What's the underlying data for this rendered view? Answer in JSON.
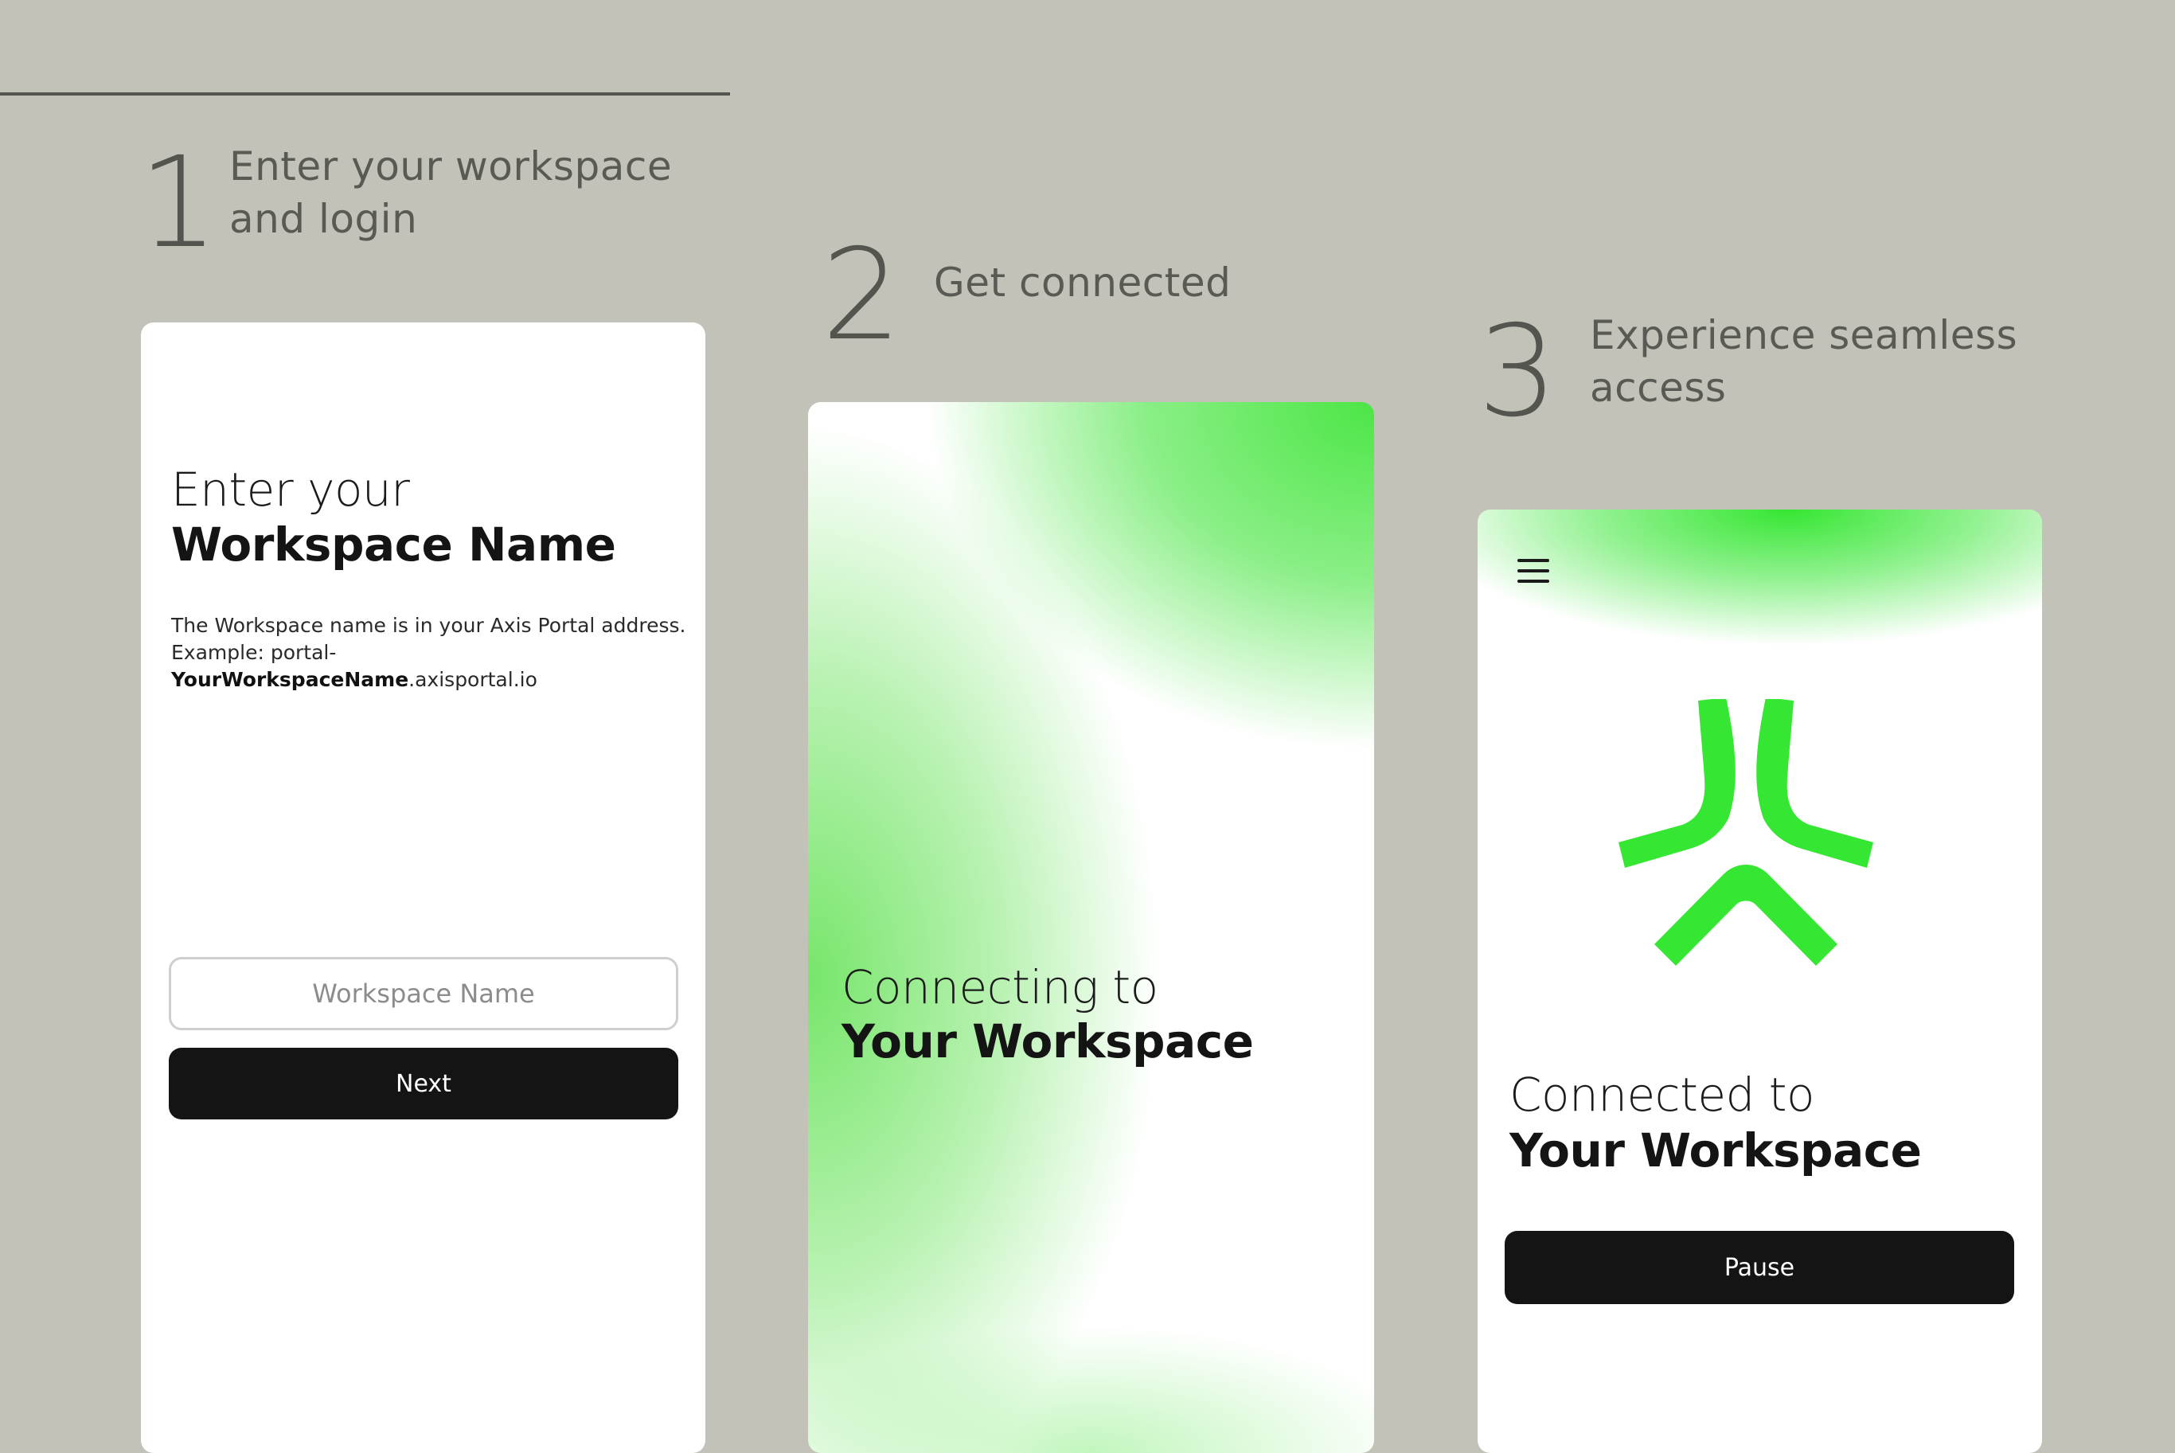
{
  "steps": [
    {
      "number": "1",
      "line1": "Enter your workspace",
      "line2": "and login"
    },
    {
      "number": "2",
      "line1": "Get connected"
    },
    {
      "number": "3",
      "line1": "Experience seamless",
      "line2": "access"
    }
  ],
  "screen1": {
    "heading_light": "Enter your",
    "heading_bold": "Workspace Name",
    "hint_line1": "The Workspace name is in your Axis Portal address.",
    "hint_prefix": "Example: portal-",
    "hint_bold": "YourWorkspaceName",
    "hint_suffix": ".axisportal.io",
    "input_placeholder": "Workspace Name",
    "button_label": "Next"
  },
  "screen2": {
    "heading_light": "Connecting to",
    "heading_bold": "Your Workspace"
  },
  "screen3": {
    "menu_icon": "hamburger-menu-icon",
    "logo_icon": "axis-logo-icon",
    "heading_light": "Connected to",
    "heading_bold": "Your Workspace",
    "button_label": "Pause"
  },
  "colors": {
    "background": "#c2c2b8",
    "accent_green": "#35e632",
    "button_dark": "#141414",
    "step_text": "#55554f"
  }
}
